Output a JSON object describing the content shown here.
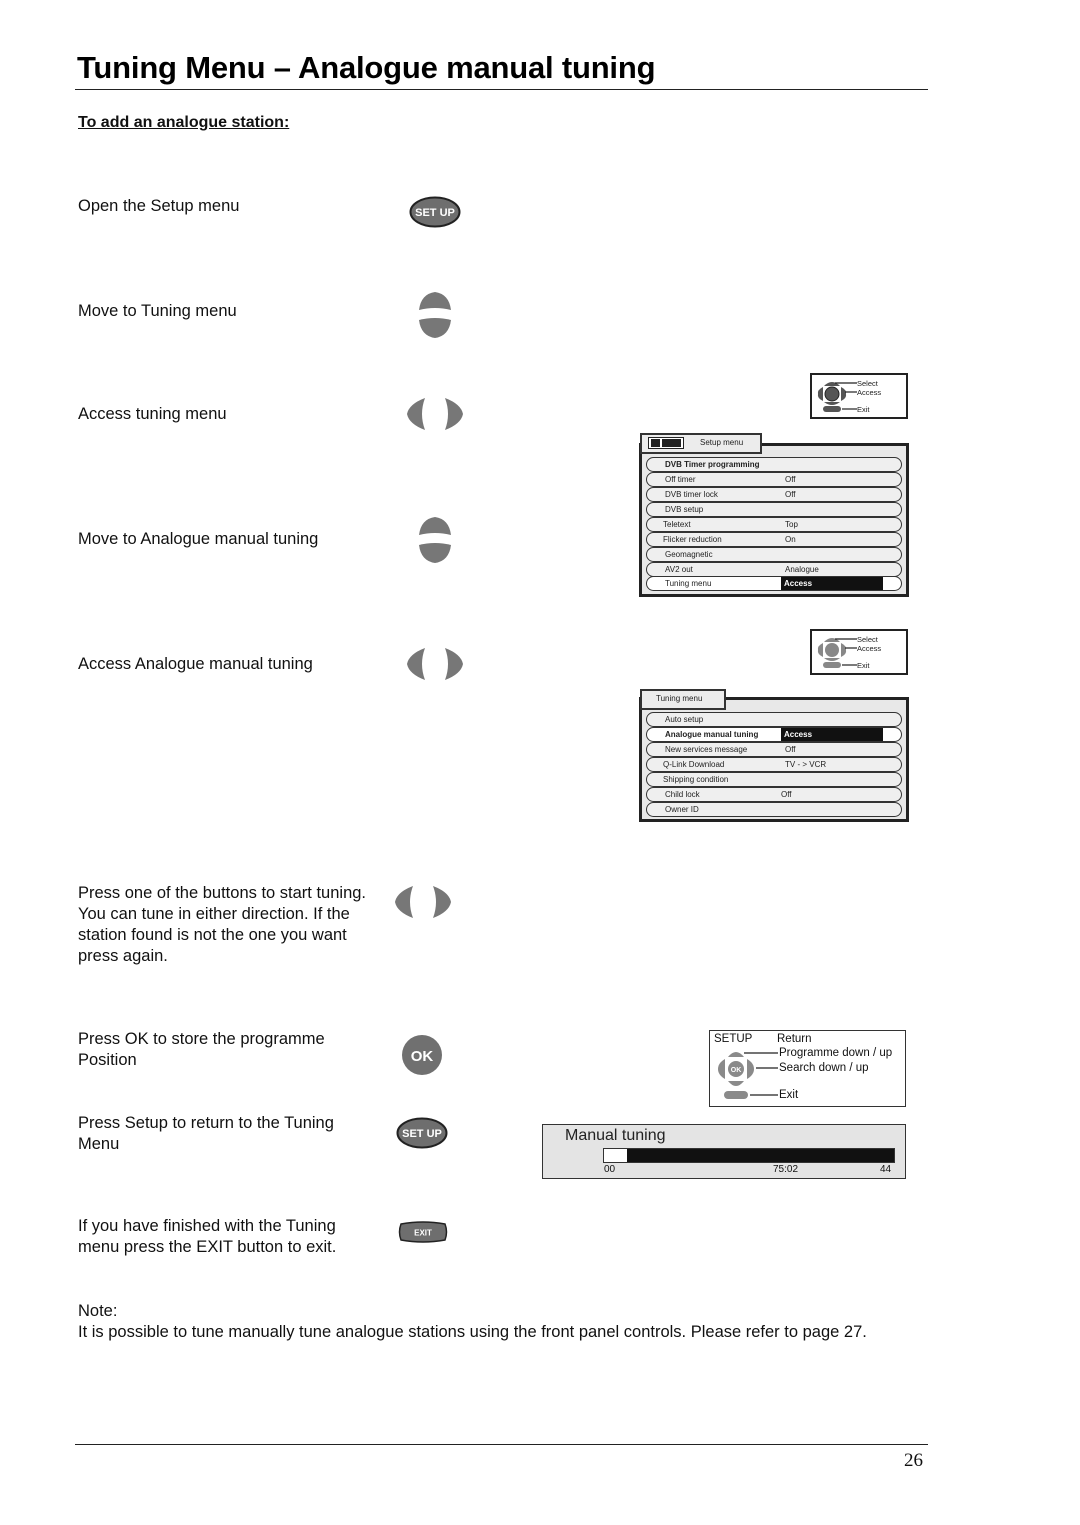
{
  "page": {
    "title": "Tuning Menu – Analogue manual tuning",
    "subtitle": "To add an analogue station:",
    "page_number": "26"
  },
  "steps": [
    {
      "text": "Open the Setup menu",
      "button": "setup-button",
      "button_label": "SET UP"
    },
    {
      "text": "Move to Tuning menu",
      "button": "up-down-buttons"
    },
    {
      "text": "Access tuning menu",
      "button": "left-right-buttons"
    },
    {
      "text": "Move to Analogue manual tuning",
      "button": "up-down-buttons"
    },
    {
      "text": "Access Analogue manual tuning",
      "button": "left-right-buttons"
    },
    {
      "text": "Press one of the buttons to start tuning. You can tune in either direction. If the station found is not the one you want press again.",
      "button": "left-right-buttons"
    },
    {
      "text": "Press OK to store the programme Position",
      "button": "ok-button",
      "button_label": "OK"
    },
    {
      "text": "Press Setup to return to the Tuning Menu",
      "button": "setup-button",
      "button_label": "SET UP"
    },
    {
      "text": "If you have finished with the Tuning menu press the EXIT button to exit.",
      "button": "exit-button",
      "button_label": "EXIT"
    }
  ],
  "legend_small": {
    "select": "Select",
    "access": "Access",
    "exit": "Exit"
  },
  "setup_menu": {
    "tab": "Setup menu",
    "rows": [
      {
        "label": "DVB Timer programming",
        "value": ""
      },
      {
        "label": "Off timer",
        "value": "Off"
      },
      {
        "label": "DVB timer  lock",
        "value": "Off"
      },
      {
        "label": "DVB setup",
        "value": ""
      },
      {
        "label": "Teletext",
        "value": "Top"
      },
      {
        "label": "Flicker reduction",
        "value": "On"
      },
      {
        "label": "Geomagnetic",
        "value": ""
      },
      {
        "label": "AV2 out",
        "value": "Analogue"
      },
      {
        "label": "Tuning menu",
        "value": "Access"
      }
    ]
  },
  "tuning_menu": {
    "tab": "Tuning menu",
    "rows": [
      {
        "label": "Auto setup",
        "value": ""
      },
      {
        "label": "Analogue manual tuning",
        "value": "Access"
      },
      {
        "label": "New services message",
        "value": "Off"
      },
      {
        "label": "Q-Link Download",
        "value": "TV - > VCR"
      },
      {
        "label": "Shipping condition",
        "value": ""
      },
      {
        "label": "Child lock",
        "value": "Off"
      },
      {
        "label": "Owner ID",
        "value": ""
      }
    ]
  },
  "legend_large": {
    "setup": "SETUP",
    "return": "Return",
    "programme": "Programme down / up",
    "search": "Search down / up",
    "exit": "Exit"
  },
  "manual_tuning": {
    "title": "Manual tuning",
    "progress_fraction": 0.08,
    "left_value": "00",
    "mid_value": "75:02",
    "right_value": "44"
  },
  "note": {
    "heading": "Note:",
    "text": "It is possible to tune manually tune analogue stations using the front panel controls. Please refer to page 27."
  }
}
